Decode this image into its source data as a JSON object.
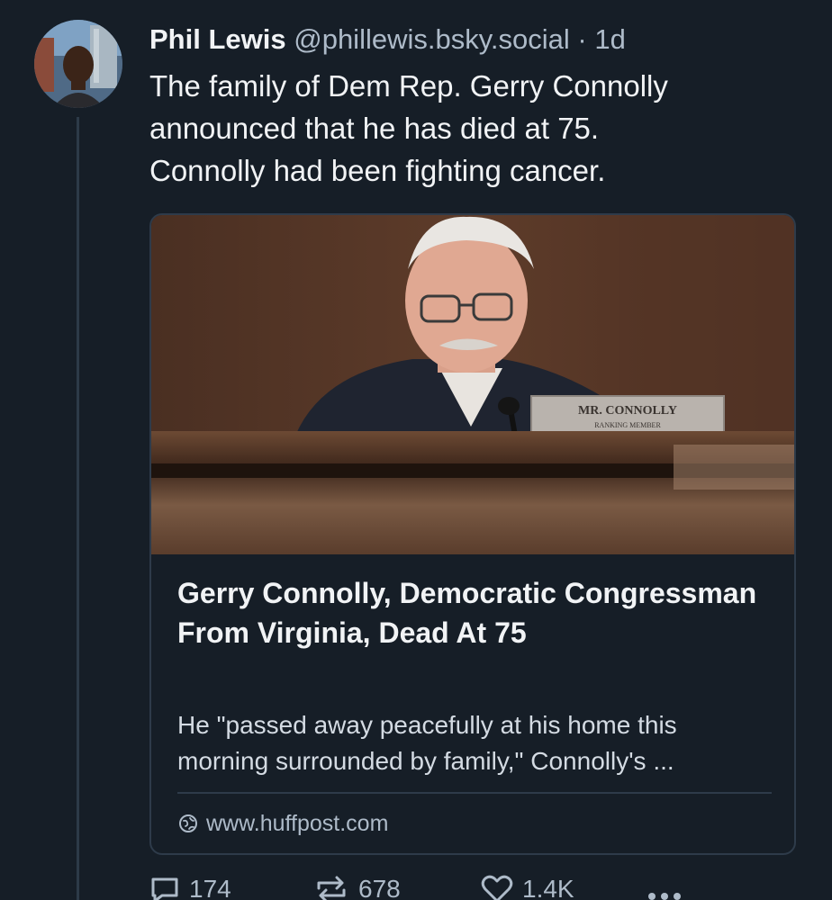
{
  "post": {
    "author": {
      "display_name": "Phil Lewis",
      "handle": "@phillewis.bsky.social",
      "separator": "·",
      "timestamp": "1d"
    },
    "text_lines": [
      "The family of Dem Rep. Gerry Connolly",
      "announced that he has died at 75.",
      "Connolly had been fighting cancer."
    ],
    "link_card": {
      "image_alt": "Gerry Connolly at a hearing desk",
      "nameplate": {
        "line1": "MR. CONNOLLY",
        "line2": "RANKING MEMBER"
      },
      "title": "Gerry Connolly, Democratic Congressman From Virginia, Dead At 75",
      "description_lines": [
        "He \"passed away peacefully at his home this",
        "morning surrounded by family,\" Connolly's ..."
      ],
      "domain": "www.huffpost.com"
    },
    "actions": {
      "replies": "174",
      "reposts": "678",
      "likes": "1.4K"
    }
  },
  "colors": {
    "background": "#161e27",
    "text_primary": "#f1f3f5",
    "text_secondary": "#aebbc9",
    "border": "#2e3b4a"
  }
}
